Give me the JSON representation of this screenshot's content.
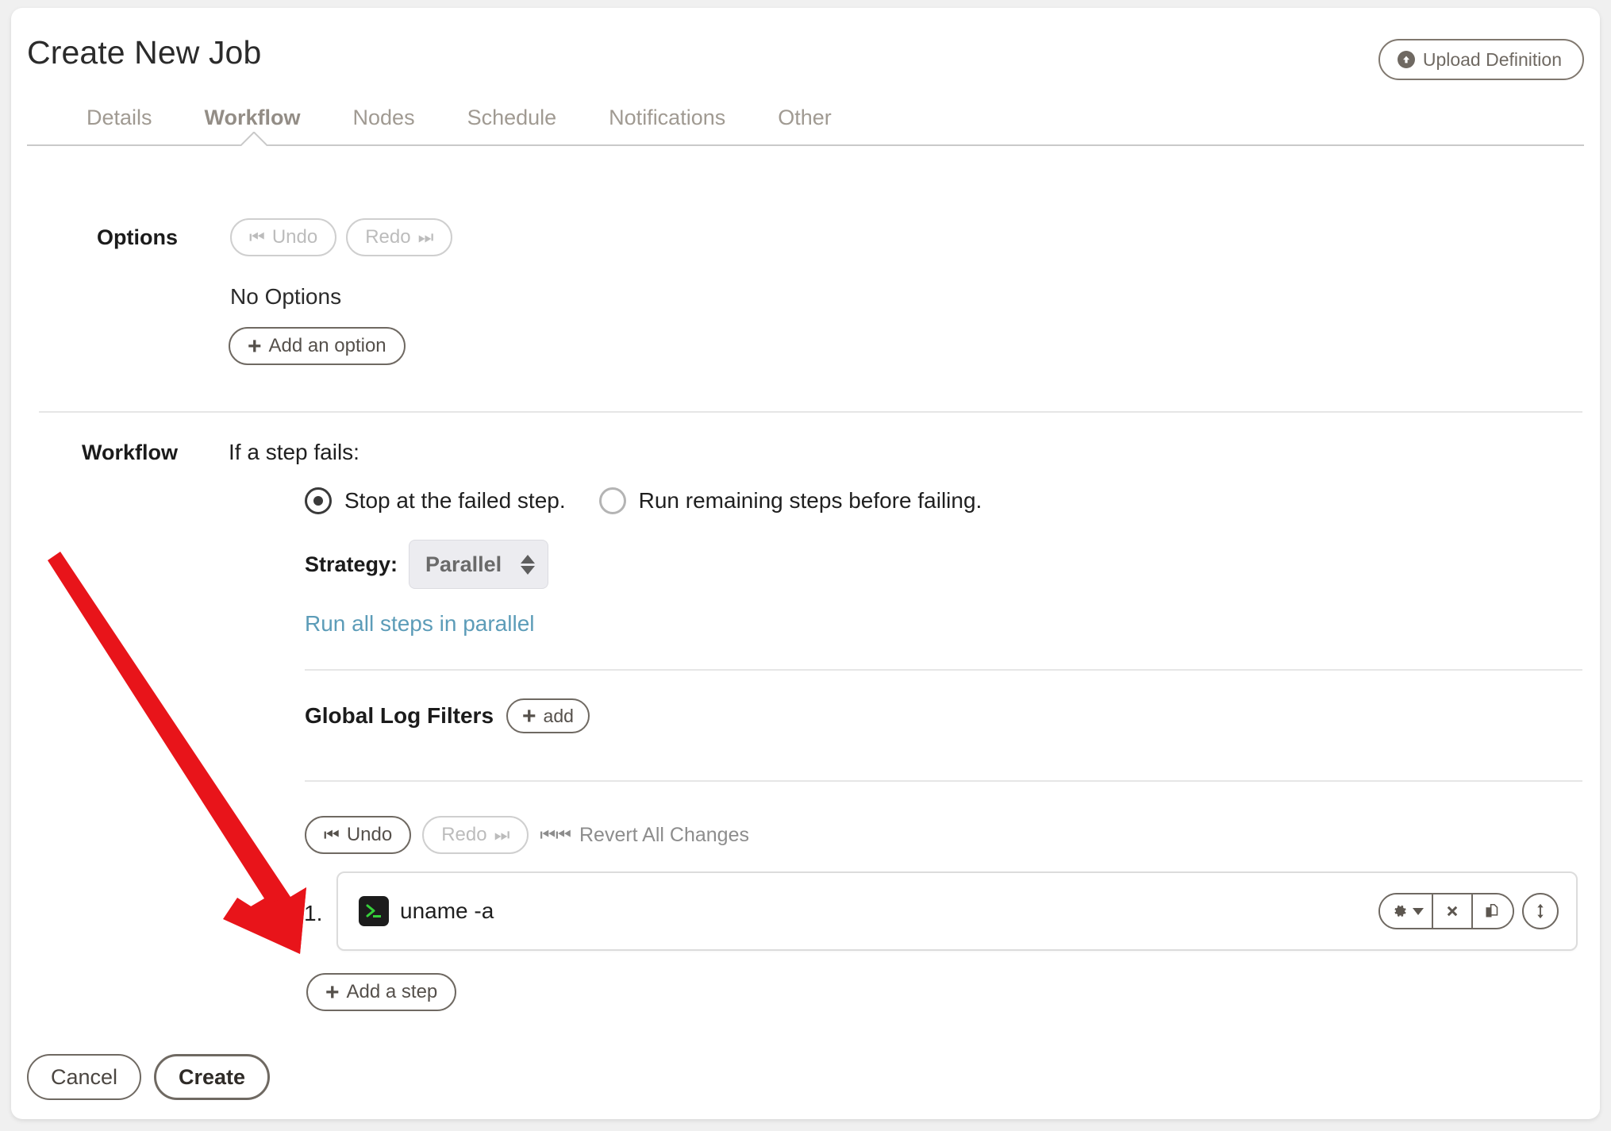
{
  "header": {
    "title": "Create New Job",
    "upload_button": "Upload Definition",
    "upload_icon": "upload-circle-icon"
  },
  "tabs": [
    {
      "label": "Details",
      "active": false
    },
    {
      "label": "Workflow",
      "active": true
    },
    {
      "label": "Nodes",
      "active": false
    },
    {
      "label": "Schedule",
      "active": false
    },
    {
      "label": "Notifications",
      "active": false
    },
    {
      "label": "Other",
      "active": false
    }
  ],
  "options_section": {
    "label": "Options",
    "undo_label": "Undo",
    "undo_enabled": false,
    "redo_label": "Redo",
    "redo_enabled": false,
    "empty_text": "No Options",
    "add_option_label": "Add an option"
  },
  "workflow_section": {
    "label": "Workflow",
    "if_step_fails_label": "If a step fails:",
    "radios": [
      {
        "label": "Stop at the failed step.",
        "selected": true
      },
      {
        "label": "Run remaining steps before failing.",
        "selected": false
      }
    ],
    "strategy_label": "Strategy:",
    "strategy_value": "Parallel",
    "strategy_options": [
      "Parallel"
    ],
    "strategy_hint": "Run all steps in parallel",
    "global_log_filters_label": "Global Log Filters",
    "global_log_filters_add": "add",
    "undo_label": "Undo",
    "undo_enabled": true,
    "redo_label": "Redo",
    "redo_enabled": false,
    "revert_label": "Revert All Changes",
    "steps": [
      {
        "number": "1.",
        "icon": "terminal-icon",
        "command": "uname -a",
        "actions": [
          "gear-dropdown-icon",
          "delete-x-icon",
          "duplicate-icon",
          "move-updown-icon"
        ]
      }
    ],
    "add_step_label": "Add a step"
  },
  "footer": {
    "cancel_label": "Cancel",
    "create_label": "Create"
  },
  "annotation": {
    "type": "arrow",
    "color": "#E8141A",
    "points_to": "add-a-step-button"
  },
  "colors": {
    "link": "#5c9cb8",
    "accent_border": "#6f6962",
    "annotation_red": "#E8141A",
    "terminal_green": "#36d13a",
    "select_bg": "#ececf0"
  }
}
